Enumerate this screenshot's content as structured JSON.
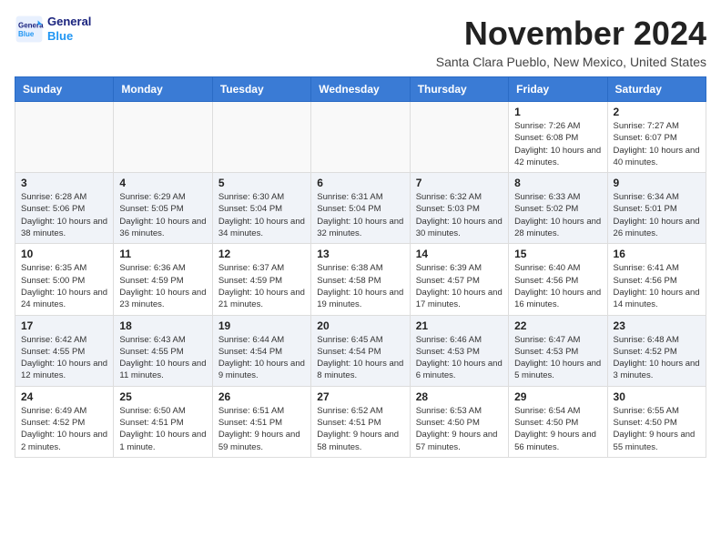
{
  "header": {
    "logo_line1": "General",
    "logo_line2": "Blue",
    "month": "November 2024",
    "location": "Santa Clara Pueblo, New Mexico, United States"
  },
  "weekdays": [
    "Sunday",
    "Monday",
    "Tuesday",
    "Wednesday",
    "Thursday",
    "Friday",
    "Saturday"
  ],
  "weeks": [
    [
      {
        "day": "",
        "info": ""
      },
      {
        "day": "",
        "info": ""
      },
      {
        "day": "",
        "info": ""
      },
      {
        "day": "",
        "info": ""
      },
      {
        "day": "",
        "info": ""
      },
      {
        "day": "1",
        "info": "Sunrise: 7:26 AM\nSunset: 6:08 PM\nDaylight: 10 hours and 42 minutes."
      },
      {
        "day": "2",
        "info": "Sunrise: 7:27 AM\nSunset: 6:07 PM\nDaylight: 10 hours and 40 minutes."
      }
    ],
    [
      {
        "day": "3",
        "info": "Sunrise: 6:28 AM\nSunset: 5:06 PM\nDaylight: 10 hours and 38 minutes."
      },
      {
        "day": "4",
        "info": "Sunrise: 6:29 AM\nSunset: 5:05 PM\nDaylight: 10 hours and 36 minutes."
      },
      {
        "day": "5",
        "info": "Sunrise: 6:30 AM\nSunset: 5:04 PM\nDaylight: 10 hours and 34 minutes."
      },
      {
        "day": "6",
        "info": "Sunrise: 6:31 AM\nSunset: 5:04 PM\nDaylight: 10 hours and 32 minutes."
      },
      {
        "day": "7",
        "info": "Sunrise: 6:32 AM\nSunset: 5:03 PM\nDaylight: 10 hours and 30 minutes."
      },
      {
        "day": "8",
        "info": "Sunrise: 6:33 AM\nSunset: 5:02 PM\nDaylight: 10 hours and 28 minutes."
      },
      {
        "day": "9",
        "info": "Sunrise: 6:34 AM\nSunset: 5:01 PM\nDaylight: 10 hours and 26 minutes."
      }
    ],
    [
      {
        "day": "10",
        "info": "Sunrise: 6:35 AM\nSunset: 5:00 PM\nDaylight: 10 hours and 24 minutes."
      },
      {
        "day": "11",
        "info": "Sunrise: 6:36 AM\nSunset: 4:59 PM\nDaylight: 10 hours and 23 minutes."
      },
      {
        "day": "12",
        "info": "Sunrise: 6:37 AM\nSunset: 4:59 PM\nDaylight: 10 hours and 21 minutes."
      },
      {
        "day": "13",
        "info": "Sunrise: 6:38 AM\nSunset: 4:58 PM\nDaylight: 10 hours and 19 minutes."
      },
      {
        "day": "14",
        "info": "Sunrise: 6:39 AM\nSunset: 4:57 PM\nDaylight: 10 hours and 17 minutes."
      },
      {
        "day": "15",
        "info": "Sunrise: 6:40 AM\nSunset: 4:56 PM\nDaylight: 10 hours and 16 minutes."
      },
      {
        "day": "16",
        "info": "Sunrise: 6:41 AM\nSunset: 4:56 PM\nDaylight: 10 hours and 14 minutes."
      }
    ],
    [
      {
        "day": "17",
        "info": "Sunrise: 6:42 AM\nSunset: 4:55 PM\nDaylight: 10 hours and 12 minutes."
      },
      {
        "day": "18",
        "info": "Sunrise: 6:43 AM\nSunset: 4:55 PM\nDaylight: 10 hours and 11 minutes."
      },
      {
        "day": "19",
        "info": "Sunrise: 6:44 AM\nSunset: 4:54 PM\nDaylight: 10 hours and 9 minutes."
      },
      {
        "day": "20",
        "info": "Sunrise: 6:45 AM\nSunset: 4:54 PM\nDaylight: 10 hours and 8 minutes."
      },
      {
        "day": "21",
        "info": "Sunrise: 6:46 AM\nSunset: 4:53 PM\nDaylight: 10 hours and 6 minutes."
      },
      {
        "day": "22",
        "info": "Sunrise: 6:47 AM\nSunset: 4:53 PM\nDaylight: 10 hours and 5 minutes."
      },
      {
        "day": "23",
        "info": "Sunrise: 6:48 AM\nSunset: 4:52 PM\nDaylight: 10 hours and 3 minutes."
      }
    ],
    [
      {
        "day": "24",
        "info": "Sunrise: 6:49 AM\nSunset: 4:52 PM\nDaylight: 10 hours and 2 minutes."
      },
      {
        "day": "25",
        "info": "Sunrise: 6:50 AM\nSunset: 4:51 PM\nDaylight: 10 hours and 1 minute."
      },
      {
        "day": "26",
        "info": "Sunrise: 6:51 AM\nSunset: 4:51 PM\nDaylight: 9 hours and 59 minutes."
      },
      {
        "day": "27",
        "info": "Sunrise: 6:52 AM\nSunset: 4:51 PM\nDaylight: 9 hours and 58 minutes."
      },
      {
        "day": "28",
        "info": "Sunrise: 6:53 AM\nSunset: 4:50 PM\nDaylight: 9 hours and 57 minutes."
      },
      {
        "day": "29",
        "info": "Sunrise: 6:54 AM\nSunset: 4:50 PM\nDaylight: 9 hours and 56 minutes."
      },
      {
        "day": "30",
        "info": "Sunrise: 6:55 AM\nSunset: 4:50 PM\nDaylight: 9 hours and 55 minutes."
      }
    ]
  ]
}
